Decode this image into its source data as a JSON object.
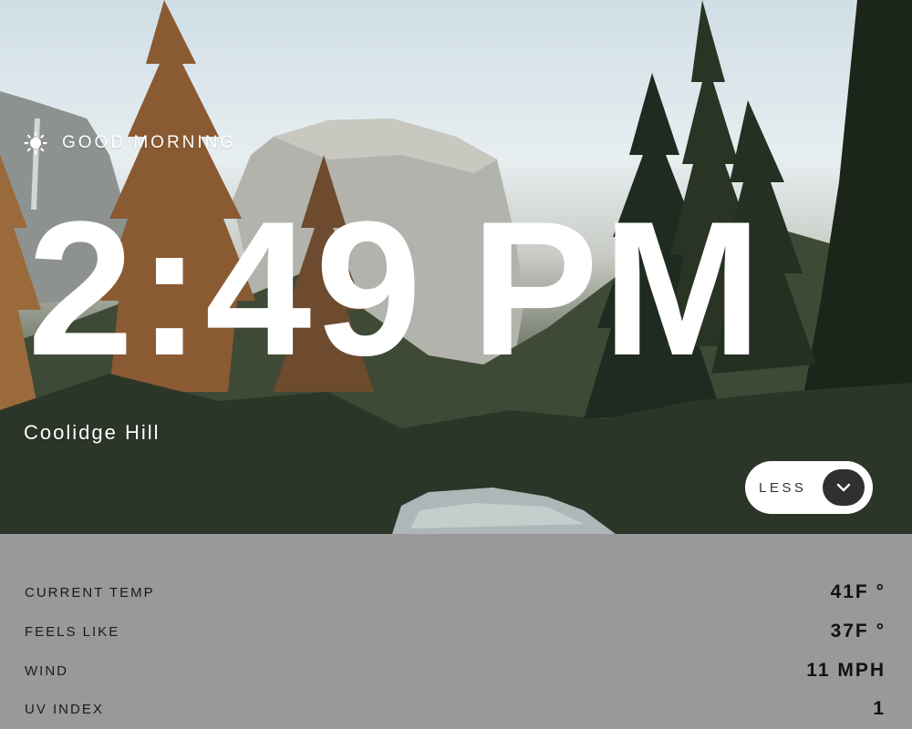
{
  "greeting": {
    "icon": "sun-icon",
    "text": "GOOD MORNING"
  },
  "clock": {
    "time": "2:49",
    "ampm": "PM"
  },
  "location": "Coolidge Hill",
  "toggle": {
    "label": "LESS",
    "icon": "chevron-down-icon"
  },
  "details": [
    {
      "label": "CURRENT TEMP",
      "value": "41F °"
    },
    {
      "label": "FEELS LIKE",
      "value": "37F °"
    },
    {
      "label": "WIND",
      "value": "11 MPH"
    },
    {
      "label": "UV INDEX",
      "value": "1"
    }
  ],
  "colors": {
    "panel_bg": "#999999",
    "text_light": "#ffffff",
    "toggle_dark": "#303030"
  }
}
